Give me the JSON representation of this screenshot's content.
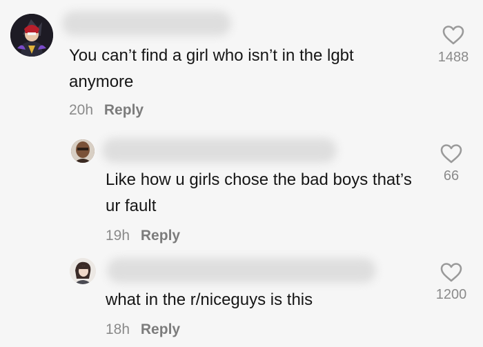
{
  "comments": [
    {
      "text": "You can’t find a girl who isn’t in the lgbt anymore",
      "time": "20h",
      "reply_label": "Reply",
      "like_count": "1488",
      "avatar_icon": "anime-character-avatar"
    },
    {
      "text": "Like how u girls chose the bad boys that’s ur fault",
      "time": "19h",
      "reply_label": "Reply",
      "like_count": "66",
      "avatar_icon": "person-photo-avatar"
    },
    {
      "text": "what in the r/niceguys is this",
      "time": "18h",
      "reply_label": "Reply",
      "like_count": "1200",
      "avatar_icon": "anime-girl-avatar"
    }
  ],
  "colors": {
    "background": "#f6f6f6",
    "text": "#161616",
    "meta": "#8a8a8a",
    "heart": "#9a9a9a"
  }
}
